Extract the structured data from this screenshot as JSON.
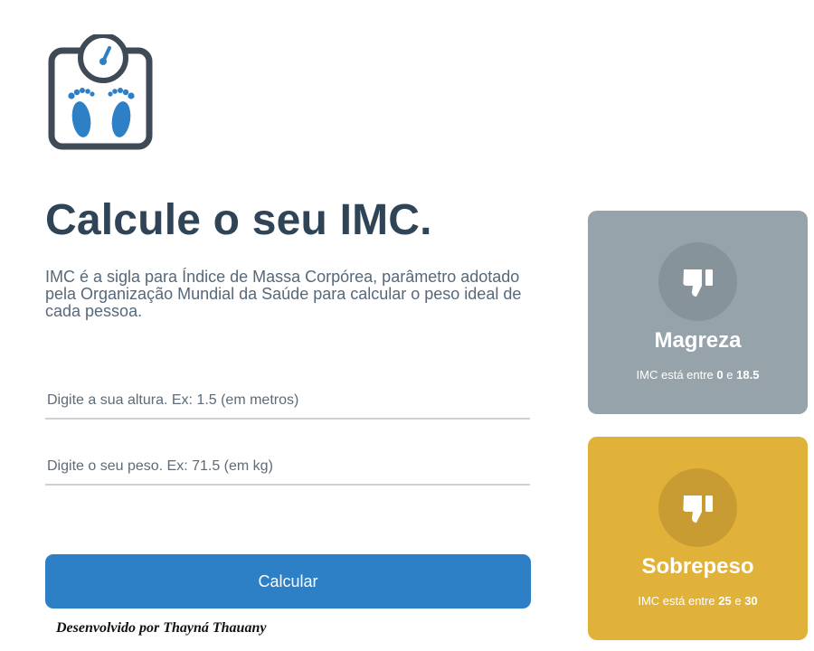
{
  "logo": {
    "icon": "bathroom-scale-icon"
  },
  "header": {
    "title": "Calcule o seu IMC.",
    "description": "IMC é a sigla para Índice de Massa Corpórea, parâmetro adotado pela Organização Mundial da Saúde para calcular o peso ideal de cada pessoa."
  },
  "form": {
    "height_placeholder": "Digite a sua altura. Ex: 1.5 (em metros)",
    "height_value": "",
    "weight_placeholder": "Digite o seu peso. Ex: 71.5 (em kg)",
    "weight_value": "",
    "submit_label": "Calcular"
  },
  "footer": {
    "credit": "Desenvolvido por Thayná Thauany"
  },
  "cards": [
    {
      "icon": "thumbs-down-icon",
      "title": "Magreza",
      "range_prefix": "IMC está entre",
      "min": "0",
      "connector": "e",
      "max": "18.5",
      "color": "#96a3ab"
    },
    {
      "icon": "thumbs-down-icon",
      "title": "Sobrepeso",
      "range_prefix": "IMC está entre",
      "min": "25",
      "connector": "e",
      "max": "30",
      "color": "#e1b23a"
    }
  ],
  "colors": {
    "title": "#2f4456",
    "button": "#2d7fc6",
    "logo_outline": "#3e4a55",
    "logo_feet": "#2d7fc6"
  }
}
